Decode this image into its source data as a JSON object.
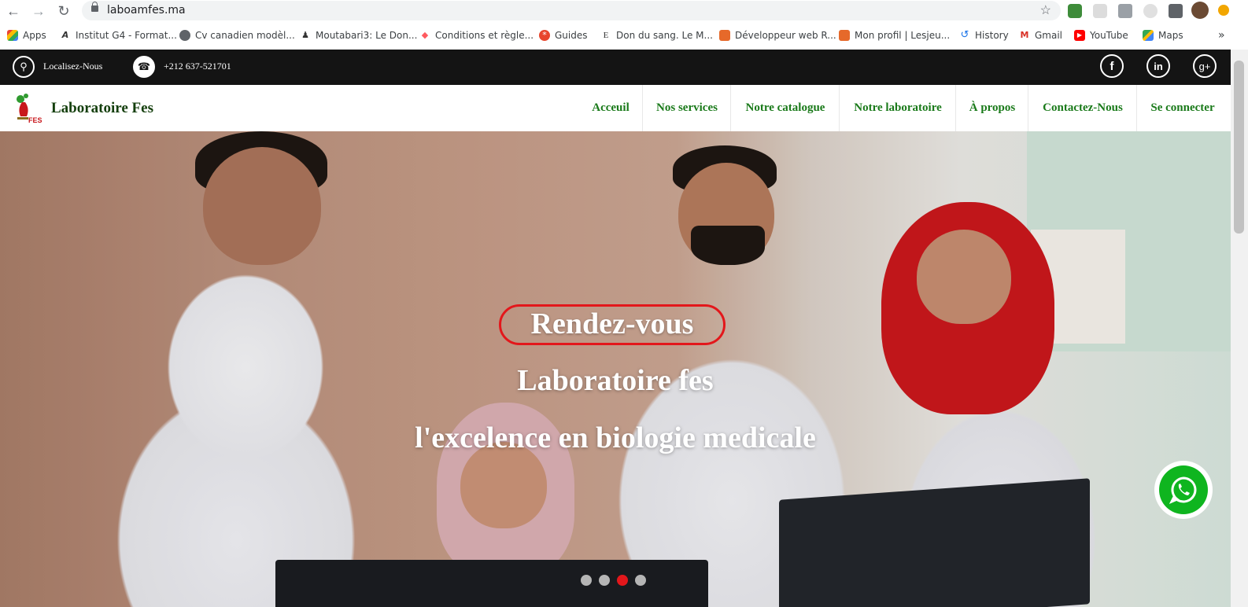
{
  "browser": {
    "url": "laboamfes.ma",
    "bookmarks": [
      {
        "label": "Apps",
        "icon": "apps-grid-icon"
      },
      {
        "label": "Institut G4 - Format...",
        "icon": "g4-icon"
      },
      {
        "label": "Cv canadien modèl...",
        "icon": "globe-icon"
      },
      {
        "label": "Moutabari3: Le Don...",
        "icon": "people-icon"
      },
      {
        "label": "Conditions et règle...",
        "icon": "airbnb-icon"
      },
      {
        "label": "Guides",
        "icon": "guides-icon"
      },
      {
        "label": "Don du sang. Le M...",
        "icon": "e-icon"
      },
      {
        "label": "Développeur web R...",
        "icon": "orange-square-icon"
      },
      {
        "label": "Mon profil | Lesjeu...",
        "icon": "orange-square-icon"
      },
      {
        "label": "History",
        "icon": "history-icon"
      },
      {
        "label": "Gmail",
        "icon": "gmail-icon"
      },
      {
        "label": "YouTube",
        "icon": "youtube-icon"
      },
      {
        "label": "Maps",
        "icon": "maps-icon"
      }
    ]
  },
  "topbar": {
    "locate_label": "Localisez-Nous",
    "phone": "+212 637-521701",
    "social": [
      "facebook-icon",
      "linkedin-icon",
      "google-plus-icon"
    ]
  },
  "nav": {
    "brand": "Laboratoire Fes",
    "logo_text": "FES",
    "items": [
      "Acceuil",
      "Nos services",
      "Notre catalogue",
      "Notre laboratoire",
      "À propos",
      "Contactez-Nous",
      "Se connecter"
    ]
  },
  "hero": {
    "cta": "Rendez-vous",
    "title": "Laboratoire fes",
    "subtitle": "l'excelence en biologie medicale",
    "slides": 4,
    "active_slide": 3
  },
  "colors": {
    "nav_green": "#1a7a1a",
    "accent_red": "#e3171b",
    "topbar_bg": "#141414",
    "whatsapp_green": "#0fb51f"
  }
}
